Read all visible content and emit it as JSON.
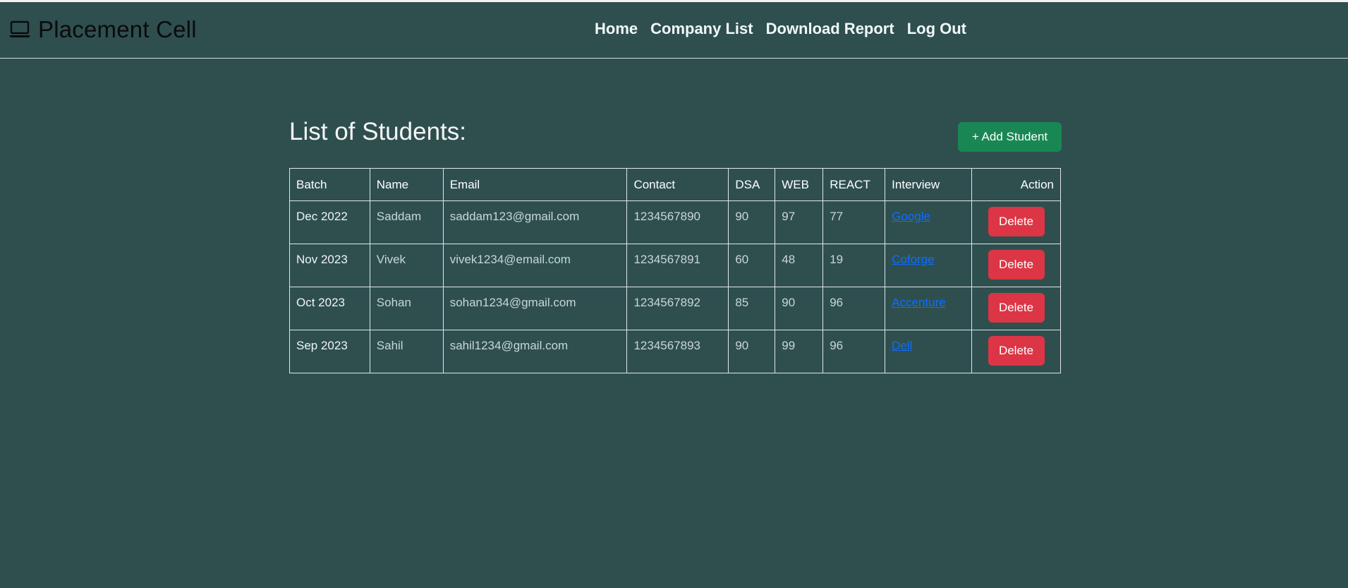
{
  "brand": {
    "title": "Placement Cell",
    "icon": "laptop-icon"
  },
  "nav": {
    "links": [
      "Home",
      "Company List",
      "Download Report",
      "Log Out"
    ]
  },
  "main": {
    "title": "List of Students:",
    "add_button": "+ Add Student"
  },
  "table": {
    "headers": [
      "Batch",
      "Name",
      "Email",
      "Contact",
      "DSA",
      "WEB",
      "REACT",
      "Interview",
      "Action"
    ],
    "rows": [
      {
        "batch": "Dec 2022",
        "name": "Saddam",
        "email": "saddam123@gmail.com",
        "contact": "1234567890",
        "dsa": "90",
        "web": "97",
        "react": "77",
        "interview": "Google",
        "action": "Delete"
      },
      {
        "batch": "Nov 2023",
        "name": "Vivek",
        "email": "vivek1234@email.com",
        "contact": "1234567891",
        "dsa": "60",
        "web": "48",
        "react": "19",
        "interview": "Coforge",
        "action": "Delete"
      },
      {
        "batch": "Oct 2023",
        "name": "Sohan",
        "email": "sohan1234@gmail.com",
        "contact": "1234567892",
        "dsa": "85",
        "web": "90",
        "react": "96",
        "interview": "Accenture",
        "action": "Delete"
      },
      {
        "batch": "Sep 2023",
        "name": "Sahil",
        "email": "sahil1234@gmail.com",
        "contact": "1234567893",
        "dsa": "90",
        "web": "99",
        "react": "96",
        "interview": "Dell",
        "action": "Delete"
      }
    ]
  },
  "colors": {
    "background": "#2f4f4f",
    "add_button": "#198754",
    "delete_button": "#dc3545",
    "link": "#0d6efd"
  }
}
